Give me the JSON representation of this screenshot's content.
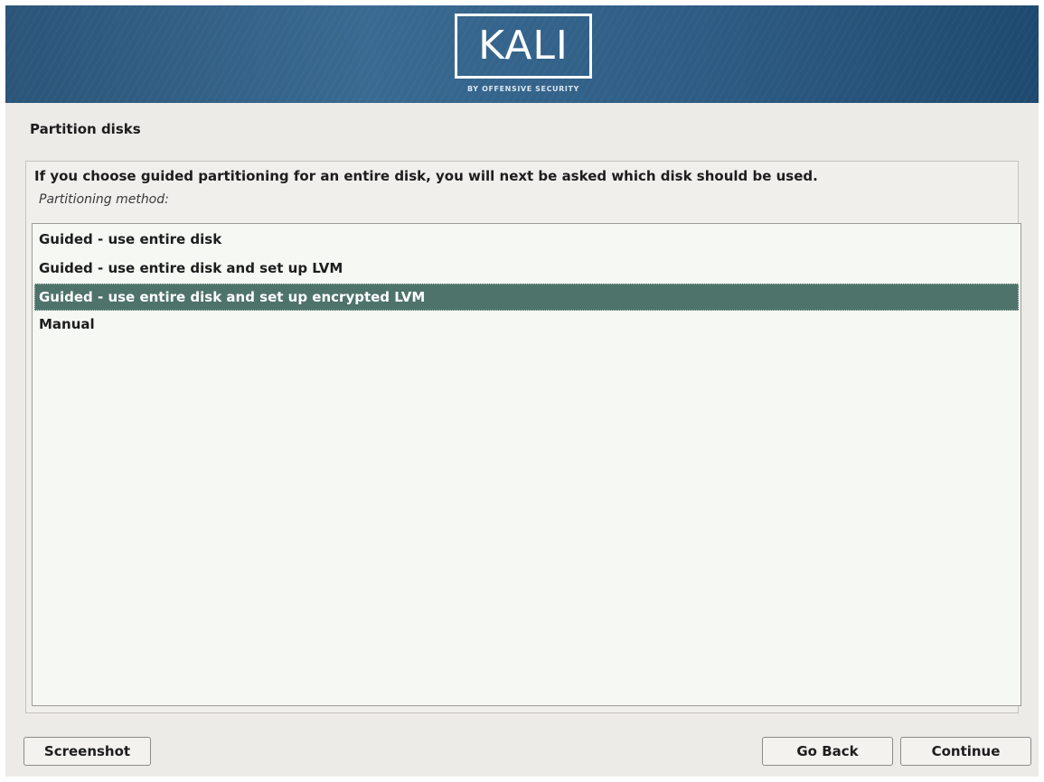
{
  "banner": {
    "logo_text": "KALI",
    "logo_subtitle": "BY OFFENSIVE SECURITY"
  },
  "page": {
    "title": "Partition disks"
  },
  "panel": {
    "question": "If you choose guided partitioning for an entire disk, you will next be asked which disk should be used.",
    "method_label": "Partitioning method:"
  },
  "options": [
    {
      "label": "Guided - use entire disk",
      "selected": false
    },
    {
      "label": "Guided - use entire disk and set up LVM",
      "selected": false
    },
    {
      "label": "Guided - use entire disk and set up encrypted LVM",
      "selected": true
    },
    {
      "label": "Manual",
      "selected": false
    }
  ],
  "buttons": {
    "screenshot": "Screenshot",
    "go_back": "Go Back",
    "continue": "Continue"
  },
  "colors": {
    "banner": "#2f5d85",
    "selection": "#4e736b",
    "background": "#edebe7",
    "list_background": "#f6f8f4"
  }
}
